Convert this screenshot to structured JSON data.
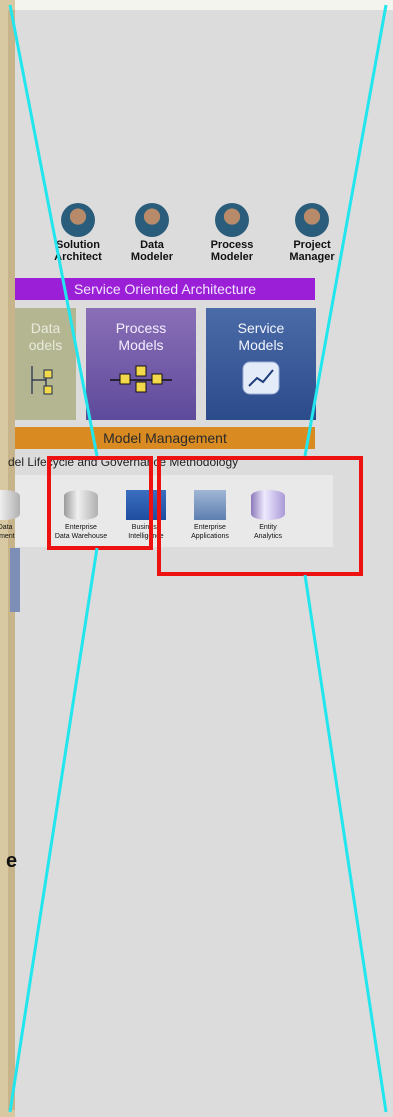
{
  "roles": [
    {
      "line1": "Solution",
      "line2": "Architect"
    },
    {
      "line1": "Data",
      "line2": "Modeler"
    },
    {
      "line1": "Process",
      "line2": "Modeler"
    },
    {
      "line1": "Project",
      "line2": "Manager"
    }
  ],
  "soa": {
    "label": "Service Oriented Architecture"
  },
  "models": [
    {
      "line1": "Data",
      "line2": "odels"
    },
    {
      "line1": "Process",
      "line2": "Models"
    },
    {
      "line1": "Service",
      "line2": "Models"
    }
  ],
  "model_management": {
    "label": "Model Management"
  },
  "lifecycle": {
    "label": "del Lifecycle and Governance Methodology"
  },
  "data_stores": [
    {
      "line1": "r Data",
      "line2": "gement"
    },
    {
      "line1": "Enterprise",
      "line2": "Data Warehouse"
    },
    {
      "line1": "Business",
      "line2": "Intelligence"
    },
    {
      "line1": "Enterprise",
      "line2": "Applications"
    },
    {
      "line1": "Entity",
      "line2": "Analytics"
    }
  ],
  "partial_text": {
    "label": "e"
  },
  "colors": {
    "soa": "#9b1fd6",
    "model_management": "#d98b22",
    "highlight": "#ee1111",
    "zoom_lines": "#22e6ee"
  }
}
